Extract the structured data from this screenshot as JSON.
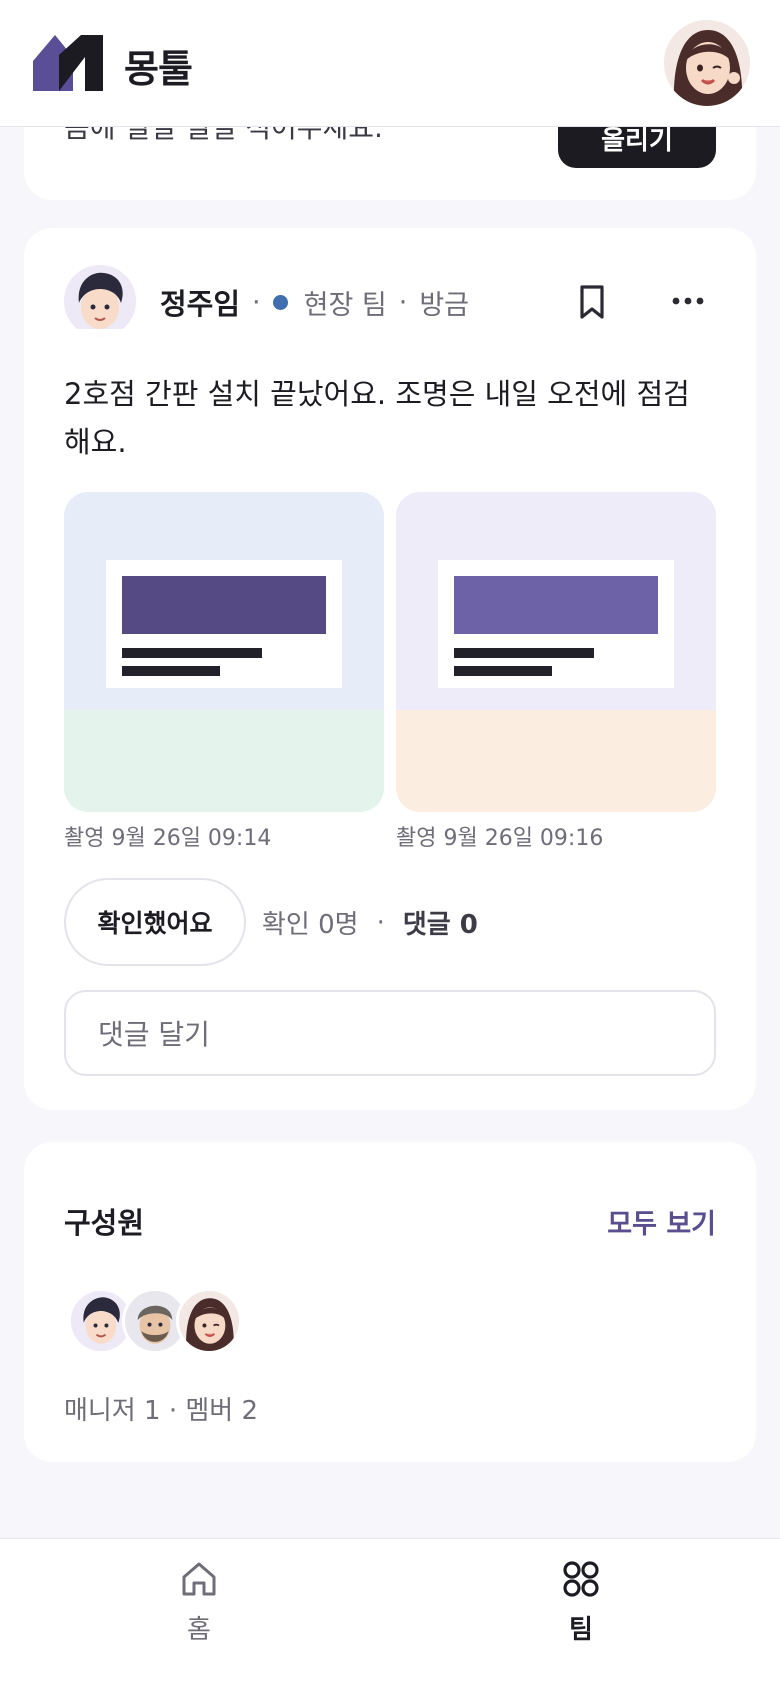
{
  "header": {
    "brand": "몽툴",
    "profile_avatar": "user-avatar-woman-winking"
  },
  "top_card": {
    "text": "음에 될일 될일 적어주세요.",
    "button_label": "올리기"
  },
  "post": {
    "author": "정주임",
    "team": "현장 팀",
    "time": "방금",
    "team_color": "#3F6FAE",
    "body": "2호점 간판 설치 끝났어요. 조명은 내일 오전에 점검해요.",
    "photos": [
      {
        "caption": "촬영 9월 26일 09:14",
        "top_color": "#E6ECF8",
        "bottom_color": "#E4F4EC",
        "sign_color": "#564A85"
      },
      {
        "caption": "촬영 9월 26일 09:16",
        "top_color": "#EEECF9",
        "bottom_color": "#FCEDE1",
        "sign_color": "#6D62A7"
      }
    ],
    "confirm_label": "확인했어요",
    "confirm_count": "확인 0명",
    "comment_count": "댓글 0",
    "comment_placeholder": "댓글 달기"
  },
  "members": {
    "title": "구성원",
    "see_all": "모두 보기",
    "summary": "매니저 1 · 멤버 2"
  },
  "nav": {
    "home_label": "홈",
    "team_label": "팀",
    "active": "팀"
  },
  "colors": {
    "accent": "#5A4E8F",
    "brand_dark": "#1C1B22",
    "background": "#F6F6FB"
  }
}
